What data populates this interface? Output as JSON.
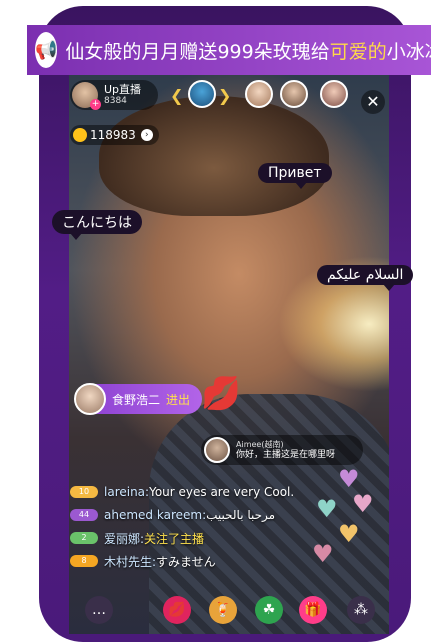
{
  "banner": {
    "icon": "megaphone-icon",
    "prefix": "仙女般的月月赠送",
    "count": "999",
    "item": "朵玫瑰给",
    "highlight": "可爱的",
    "receiver": "小冰冰"
  },
  "host": {
    "name": "Up直播",
    "id": "8384"
  },
  "coins": {
    "amount": "118983"
  },
  "bubbles": {
    "russian": "Привет",
    "japanese": "こんにちは",
    "arabic": "السلام عليكم"
  },
  "entrant": {
    "name": "食野浩二",
    "action": "进出"
  },
  "message_card": {
    "sender": "Aimee(越南)",
    "text": "你好，主播这是在哪里呀"
  },
  "chat": [
    {
      "level": "10",
      "level_color": "#f5b942",
      "user": "lareina:",
      "text": " Your eyes are very Cool.",
      "text_color": "#ffffff"
    },
    {
      "level": "44",
      "level_color": "#9b59d0",
      "user": "ahemed kareem:",
      "text": " مرحبا بالحبيب",
      "text_color": "#ffffff"
    },
    {
      "level": "2",
      "level_color": "#6ac36a",
      "user": "爱丽娜:",
      "text": " 关注了主播",
      "text_color": "#ffe14d"
    },
    {
      "level": "8",
      "level_color": "#f5a623",
      "user": "木村先生:",
      "text": " すみません",
      "text_color": "#ffffff"
    }
  ],
  "bottom_bar": [
    {
      "icon": "chat-bubble-icon",
      "color": "#3a2f4a"
    },
    {
      "icon": "lips-icon",
      "color": "#e0245e"
    },
    {
      "icon": "drink-icon",
      "color": "#e8a33a"
    },
    {
      "icon": "clover-icon",
      "color": "#2ea44f"
    },
    {
      "icon": "gift-icon",
      "color": "#ff3d89"
    },
    {
      "icon": "more-icon",
      "color": "#3a2f4a"
    }
  ],
  "colors": {
    "accent": "#8a3fd0",
    "banner_start": "#7b2fb0",
    "banner_end": "#a855d6",
    "pink": "#ff3d89",
    "gold": "#ffc21a"
  }
}
